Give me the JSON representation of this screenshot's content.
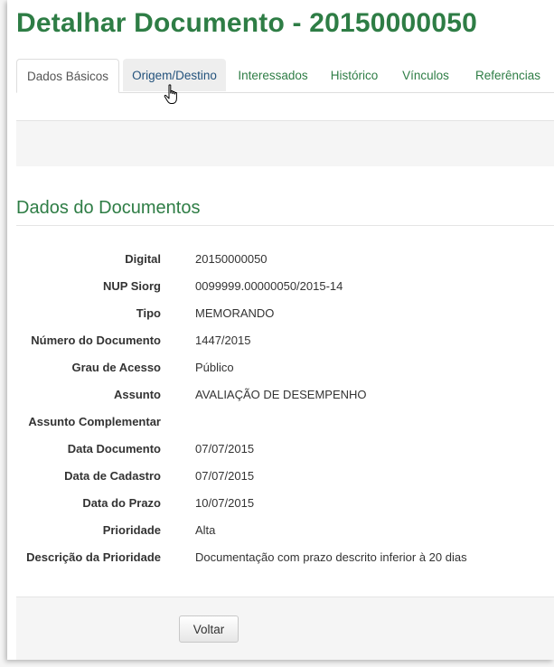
{
  "header": {
    "title": "Detalhar Documento - 20150000050"
  },
  "tabs": [
    {
      "label": "Dados Básicos",
      "active": true
    },
    {
      "label": "Origem/Destino",
      "hover": true
    },
    {
      "label": "Interessados"
    },
    {
      "label": "Histórico"
    },
    {
      "label": "Vínculos"
    },
    {
      "label": "Referências"
    }
  ],
  "section": {
    "title": "Dados do Documentos"
  },
  "fields": [
    {
      "label": "Digital",
      "value": "20150000050"
    },
    {
      "label": "NUP Siorg",
      "value": "0099999.00000050/2015-14"
    },
    {
      "label": "Tipo",
      "value": "MEMORANDO"
    },
    {
      "label": "Número do Documento",
      "value": "1447/2015"
    },
    {
      "label": "Grau de Acesso",
      "value": "Público"
    },
    {
      "label": "Assunto",
      "value": "AVALIAÇÃO DE DESEMPENHO"
    },
    {
      "label": "Assunto Complementar",
      "value": ""
    },
    {
      "label": "Data Documento",
      "value": "07/07/2015"
    },
    {
      "label": "Data de Cadastro",
      "value": "07/07/2015"
    },
    {
      "label": "Data do Prazo",
      "value": "10/07/2015"
    },
    {
      "label": "Prioridade",
      "value": "Alta"
    },
    {
      "label": "Descrição da Prioridade",
      "value": "Documentação com prazo descrito inferior à 20 dias"
    }
  ],
  "footer": {
    "back_label": "Voltar"
  },
  "colors": {
    "accent": "#2e7d45",
    "link_hover": "#23527c",
    "panel": "#f5f5f5"
  },
  "icons": {
    "cursor": "hand-pointer-icon"
  }
}
